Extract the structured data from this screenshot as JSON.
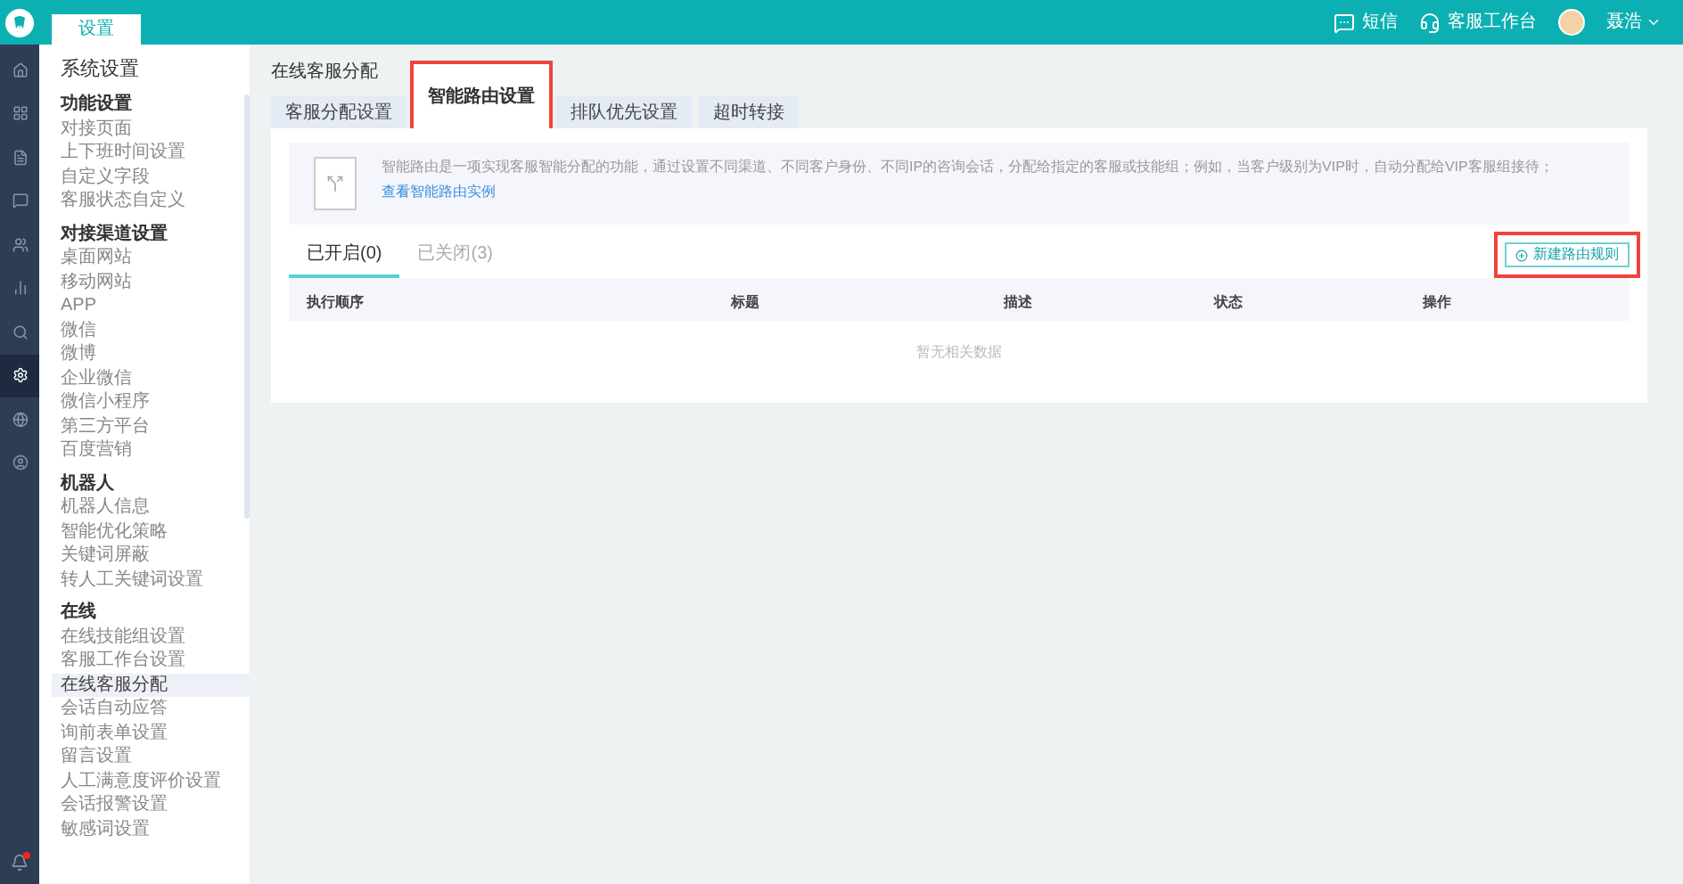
{
  "topbar": {
    "tab": "设置",
    "actions": [
      {
        "kind": "sms",
        "label": "短信"
      },
      {
        "kind": "workbench",
        "label": "客服工作台"
      }
    ],
    "user": "聂浩"
  },
  "rail": [
    {
      "kind": "home",
      "selected": false
    },
    {
      "kind": "grid",
      "selected": false
    },
    {
      "kind": "doc",
      "selected": false
    },
    {
      "kind": "chat",
      "selected": false
    },
    {
      "kind": "users",
      "selected": false
    },
    {
      "kind": "chart",
      "selected": false
    },
    {
      "kind": "search",
      "selected": false
    },
    {
      "kind": "settings",
      "selected": true
    },
    {
      "kind": "globe",
      "selected": false
    },
    {
      "kind": "user",
      "selected": false
    }
  ],
  "notification": {
    "unread": true
  },
  "sidebar": {
    "title": "系统设置",
    "sections": [
      {
        "heading": "功能设置",
        "items": [
          {
            "label": "对接页面",
            "selected": false
          },
          {
            "label": "上下班时间设置",
            "selected": false
          },
          {
            "label": "自定义字段",
            "selected": false
          },
          {
            "label": "客服状态自定义",
            "selected": false
          }
        ]
      },
      {
        "heading": "对接渠道设置",
        "items": [
          {
            "label": "桌面网站",
            "selected": false
          },
          {
            "label": "移动网站",
            "selected": false
          },
          {
            "label": "APP",
            "selected": false
          },
          {
            "label": "微信",
            "selected": false
          },
          {
            "label": "微博",
            "selected": false
          },
          {
            "label": "企业微信",
            "selected": false
          },
          {
            "label": "微信小程序",
            "selected": false
          },
          {
            "label": "第三方平台",
            "selected": false
          },
          {
            "label": "百度营销",
            "selected": false
          }
        ]
      },
      {
        "heading": "机器人",
        "items": [
          {
            "label": "机器人信息",
            "selected": false
          },
          {
            "label": "智能优化策略",
            "selected": false
          },
          {
            "label": "关键词屏蔽",
            "selected": false
          },
          {
            "label": "转人工关键词设置",
            "selected": false
          }
        ]
      },
      {
        "heading": "在线",
        "items": [
          {
            "label": "在线技能组设置",
            "selected": false
          },
          {
            "label": "客服工作台设置",
            "selected": false
          },
          {
            "label": "在线客服分配",
            "selected": true
          },
          {
            "label": "会话自动应答",
            "selected": false
          },
          {
            "label": "询前表单设置",
            "selected": false
          },
          {
            "label": "留言设置",
            "selected": false
          },
          {
            "label": "人工满意度评价设置",
            "selected": false
          },
          {
            "label": "会话报警设置",
            "selected": false
          },
          {
            "label": "敏感词设置",
            "selected": false
          }
        ]
      }
    ]
  },
  "page": {
    "title": "在线客服分配",
    "tabs": [
      {
        "label": "客服分配设置",
        "selected": false,
        "highlighted": false
      },
      {
        "label": "智能路由设置",
        "selected": true,
        "highlighted": true
      },
      {
        "label": "排队优先设置",
        "selected": false,
        "highlighted": false
      },
      {
        "label": "超时转接",
        "selected": false,
        "highlighted": false
      }
    ],
    "intro": {
      "text": "智能路由是一项实现客服智能分配的功能，通过设置不同渠道、不同客户身份、不同IP的咨询会话，分配给指定的客服或技能组；例如，当客户级别为VIP时，自动分配给VIP客服组接待；",
      "link": "查看智能路由实例"
    },
    "subtabs": [
      {
        "label": "已开启(0)",
        "selected": true
      },
      {
        "label": "已关闭(3)",
        "selected": false
      }
    ],
    "new_button": {
      "label": "新建路由规则",
      "highlighted": true
    },
    "table": {
      "columns": [
        "执行顺序",
        "标题",
        "描述",
        "状态",
        "操作"
      ],
      "empty": "暂无相关数据"
    }
  }
}
